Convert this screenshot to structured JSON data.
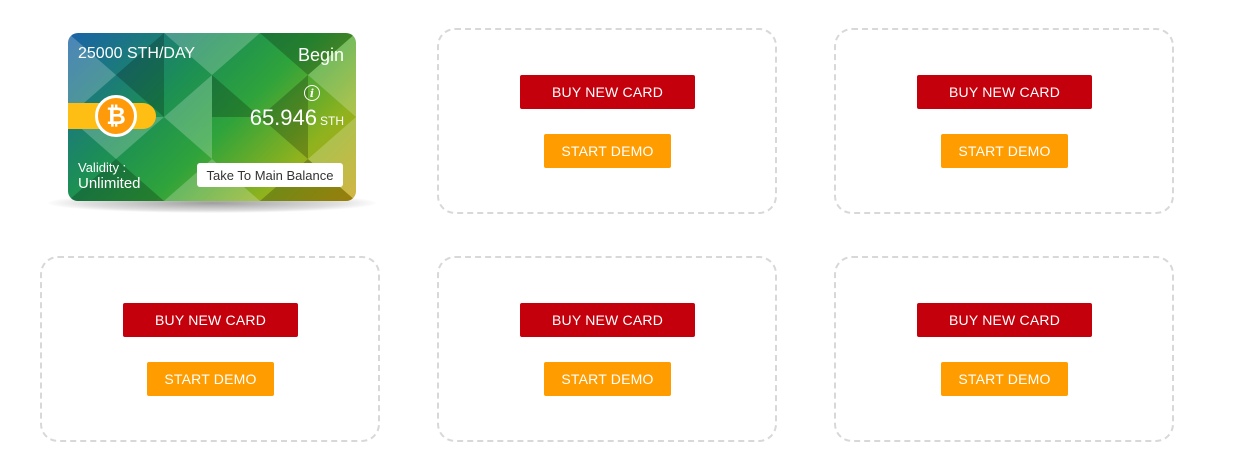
{
  "active_card": {
    "title": "25000 STH/DAY",
    "status": "Begin",
    "coin_symbol": "₿",
    "info_symbol": "i",
    "amount": "65.946",
    "unit": "STH",
    "validity_label": "Validity :",
    "validity_value": "Unlimited",
    "take_button": "Take To Main Balance",
    "colors": {
      "stripe": "#ffbe14",
      "coin": "#ff9a0a"
    }
  },
  "slots": [
    {
      "buy_label": "BUY NEW CARD",
      "demo_label": "START DEMO"
    },
    {
      "buy_label": "BUY NEW CARD",
      "demo_label": "START DEMO"
    },
    {
      "buy_label": "BUY NEW CARD",
      "demo_label": "START DEMO"
    },
    {
      "buy_label": "BUY NEW CARD",
      "demo_label": "START DEMO"
    },
    {
      "buy_label": "BUY NEW CARD",
      "demo_label": "START DEMO"
    }
  ],
  "colors": {
    "buy": "#c4000c",
    "demo": "#ff9d00",
    "slot_border": "#d8d8d8"
  },
  "icons": {
    "coin": "bitcoin-icon",
    "info": "info-icon"
  }
}
